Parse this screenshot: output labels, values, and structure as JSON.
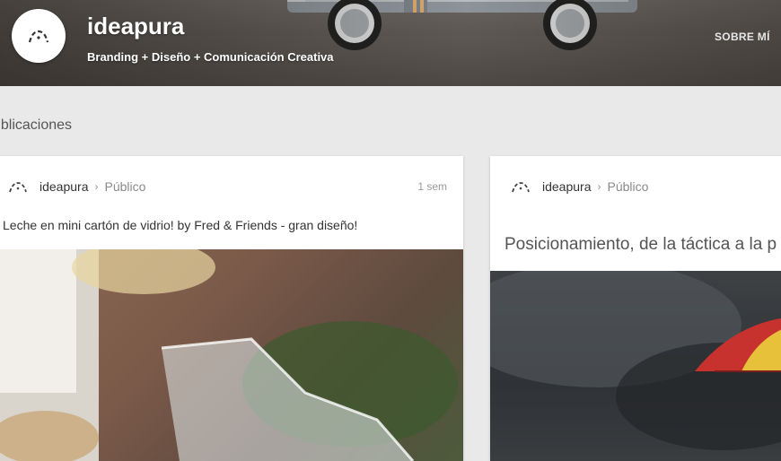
{
  "header": {
    "brand_name": "ideapura",
    "tagline": "Branding + Diseño + Comunicación Creativa",
    "nav_about": "SOBRE MÍ"
  },
  "section": {
    "title": "ublicaciones"
  },
  "posts": [
    {
      "author": "ideapura",
      "separator": "›",
      "visibility": "Público",
      "time": "1 sem",
      "text": "Leche en mini cartón de vidrio! by Fred & Friends - gran diseño!"
    },
    {
      "author": "ideapura",
      "separator": "›",
      "visibility": "Público",
      "title": "Posicionamiento, de la táctica a la p"
    }
  ],
  "colors": {
    "background": "#e9e9e9",
    "card": "#ffffff",
    "text": "#333333",
    "muted": "#8a8a8a"
  },
  "icons": [
    "ideapura-logo-icon",
    "chevron-right-icon"
  ]
}
